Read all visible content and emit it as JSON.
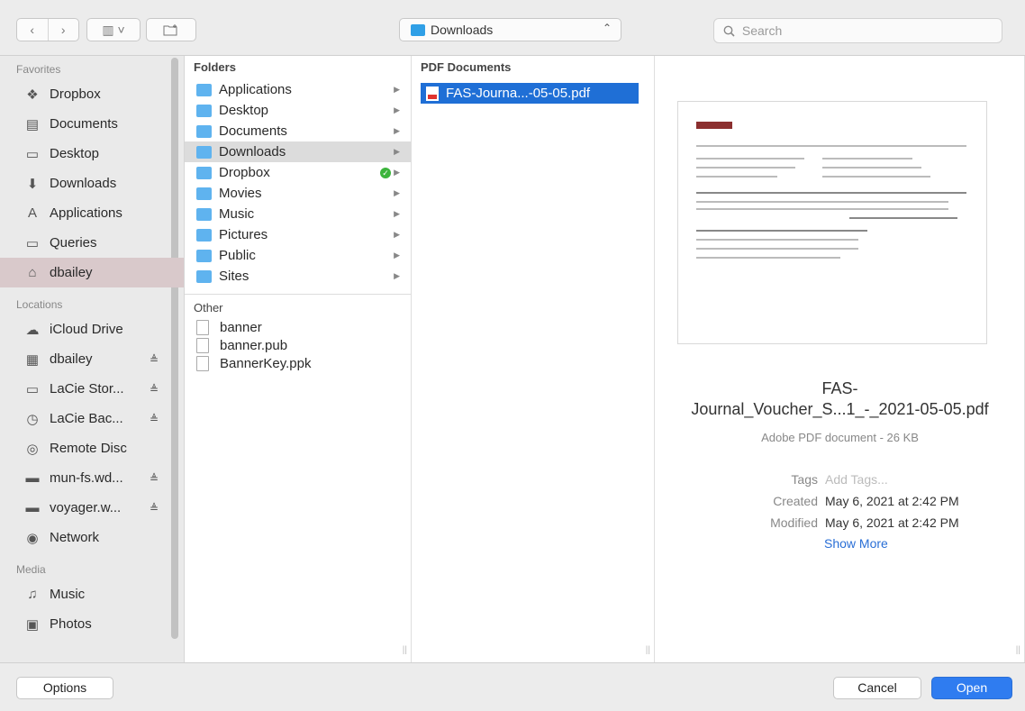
{
  "toolbar": {
    "back": "‹",
    "forward": "›",
    "view": "▥ ˅",
    "path_folder": "Downloads",
    "search_placeholder": "Search"
  },
  "sidebar": {
    "favorites_header": "Favorites",
    "favorites": [
      {
        "label": "Dropbox",
        "icon": "dropbox-icon"
      },
      {
        "label": "Documents",
        "icon": "documents-icon"
      },
      {
        "label": "Desktop",
        "icon": "desktop-icon"
      },
      {
        "label": "Downloads",
        "icon": "downloads-icon"
      },
      {
        "label": "Applications",
        "icon": "applications-icon"
      },
      {
        "label": "Queries",
        "icon": "folder-icon"
      },
      {
        "label": "dbailey",
        "icon": "home-icon"
      }
    ],
    "locations_header": "Locations",
    "locations": [
      {
        "label": "iCloud Drive",
        "icon": "cloud-icon",
        "eject": ""
      },
      {
        "label": "dbailey",
        "icon": "disk-icon",
        "eject": "≜"
      },
      {
        "label": "LaCie Stor...",
        "icon": "drive-icon",
        "eject": "≜"
      },
      {
        "label": "LaCie Bac...",
        "icon": "timemachine-icon",
        "eject": "≜"
      },
      {
        "label": "Remote Disc",
        "icon": "disc-icon",
        "eject": ""
      },
      {
        "label": "mun-fs.wd...",
        "icon": "server-icon",
        "eject": "≜"
      },
      {
        "label": "voyager.w...",
        "icon": "server-icon",
        "eject": "≜"
      },
      {
        "label": "Network",
        "icon": "network-icon",
        "eject": ""
      }
    ],
    "media_header": "Media",
    "media": [
      {
        "label": "Music",
        "icon": "music-icon"
      },
      {
        "label": "Photos",
        "icon": "photos-icon"
      }
    ]
  },
  "folders_column": {
    "header": "Folders",
    "items": [
      "Applications",
      "Desktop",
      "Documents",
      "Downloads",
      "Dropbox",
      "Movies",
      "Music",
      "Pictures",
      "Public",
      "Sites"
    ],
    "selected": "Downloads",
    "other_header": "Other",
    "other_items": [
      "banner",
      "banner.pub",
      "BannerKey.ppk"
    ]
  },
  "pdf_column": {
    "header": "PDF Documents",
    "items": [
      "FAS-Journa...-05-05.pdf"
    ]
  },
  "preview": {
    "title_line1": "FAS-",
    "title_line2": "Journal_Voucher_S...1_-_2021-05-05.pdf",
    "subtitle": "Adobe PDF document - 26 KB",
    "tags_label": "Tags",
    "tags_value": "Add Tags...",
    "created_label": "Created",
    "created_value": "May 6, 2021 at 2:42 PM",
    "modified_label": "Modified",
    "modified_value": "May 6, 2021 at 2:42 PM",
    "show_more": "Show More"
  },
  "bottombar": {
    "options": "Options",
    "cancel": "Cancel",
    "open": "Open"
  }
}
